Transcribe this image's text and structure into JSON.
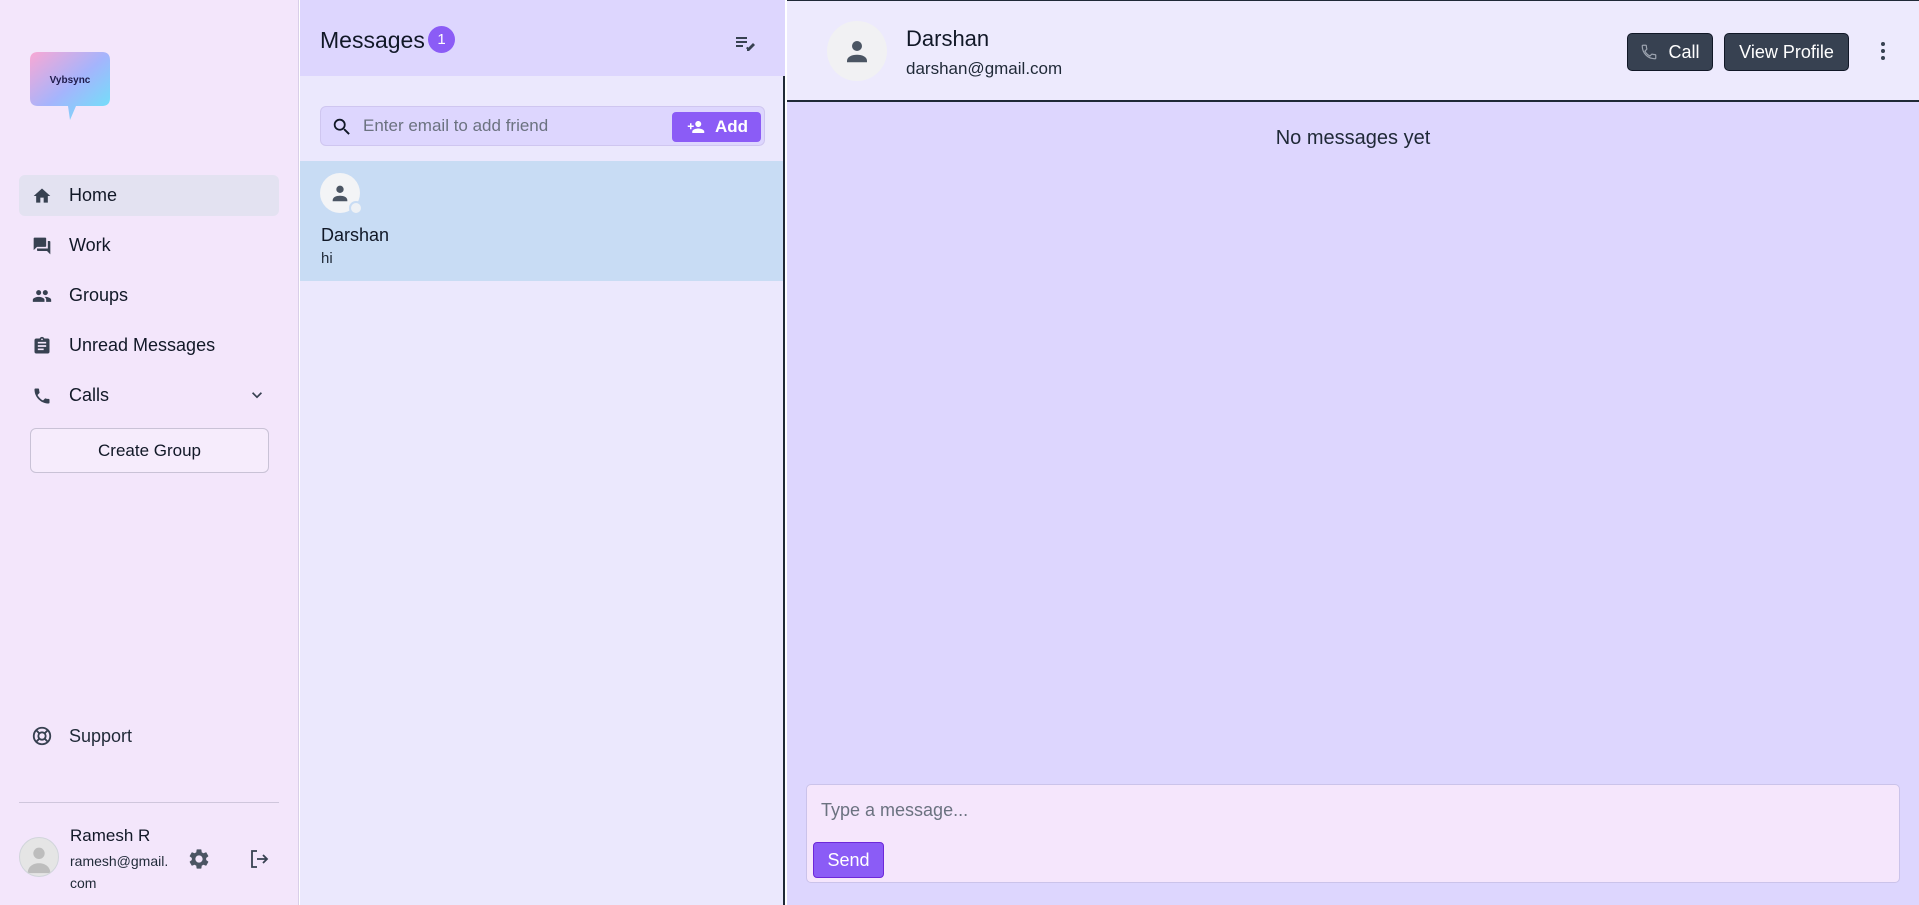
{
  "app": {
    "logo_text": "Vybsync",
    "accent_color": "#8b5cf6"
  },
  "sidebar": {
    "items": [
      {
        "label": "Home",
        "icon": "home-icon",
        "active": true
      },
      {
        "label": "Work",
        "icon": "forum-icon"
      },
      {
        "label": "Groups",
        "icon": "people-icon"
      },
      {
        "label": "Unread Messages",
        "icon": "clipboard-icon"
      },
      {
        "label": "Calls",
        "icon": "phone-icon",
        "expandable": true
      }
    ],
    "create_group_label": "Create Group",
    "support_label": "Support",
    "user": {
      "name": "Ramesh R",
      "email": "ramesh@gmail.com"
    }
  },
  "messages_panel": {
    "title": "Messages",
    "badge_count": "1",
    "search_placeholder": "Enter email to add friend",
    "add_label": "Add",
    "chats": [
      {
        "name": "Darshan",
        "last_message": "hi"
      }
    ]
  },
  "chat": {
    "contact_name": "Darshan",
    "contact_email": "darshan@gmail.com",
    "call_label": "Call",
    "view_profile_label": "View Profile",
    "empty_text": "No messages yet",
    "input_placeholder": "Type a message...",
    "send_label": "Send"
  }
}
